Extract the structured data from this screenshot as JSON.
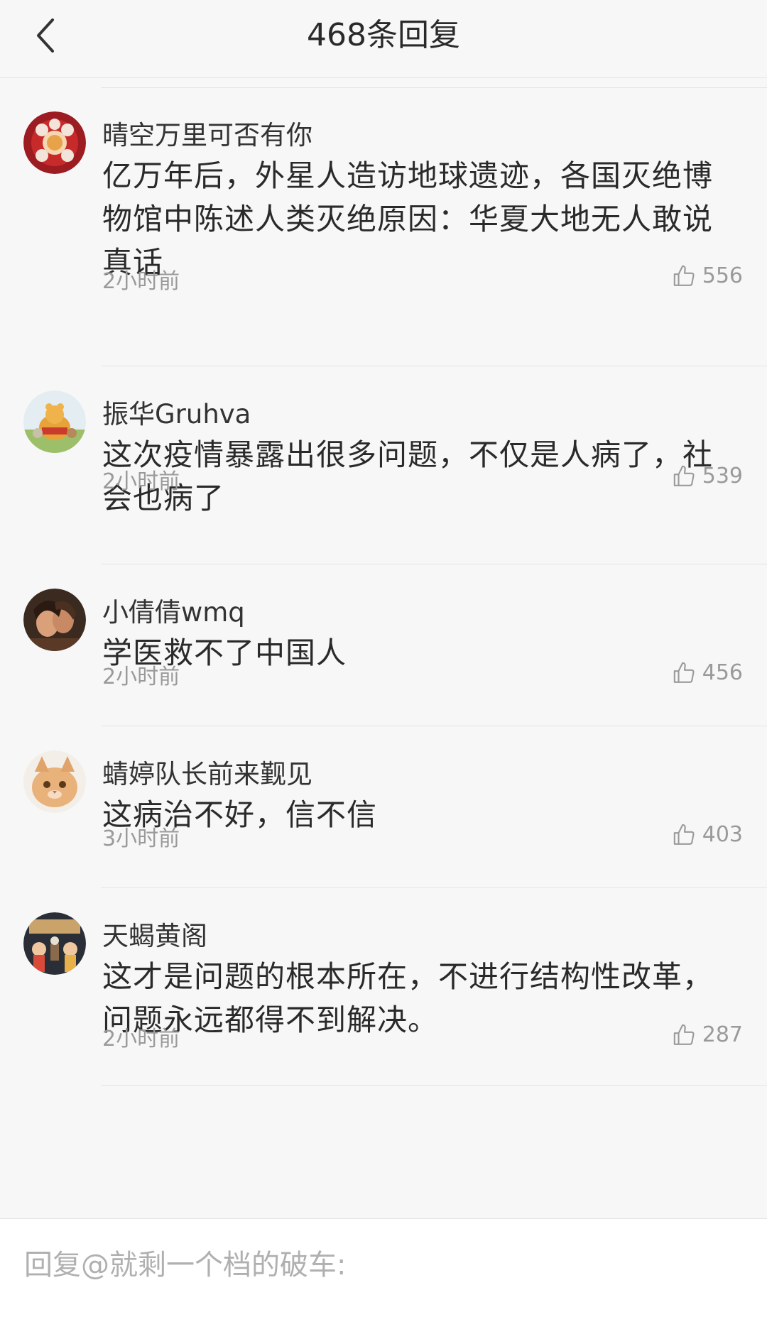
{
  "header": {
    "title": "468条回复"
  },
  "comments": [
    {
      "username": "晴空万里可否有你",
      "content": "亿万年后，外星人造访地球遗迹，各国灭绝博物馆中陈述人类灭绝原因：华夏大地无人敢说真话",
      "time": "2小时前",
      "likes": "556",
      "avatar": "lantern-avatar"
    },
    {
      "username": "振华Gruhva",
      "content": "这次疫情暴露出很多问题，不仅是人病了，社会也病了",
      "time": "2小时前",
      "likes": "539",
      "avatar": "cartoon-bear-avatar"
    },
    {
      "username": "小倩倩wmq",
      "content": "学医救不了中国人",
      "time": "2小时前",
      "likes": "456",
      "avatar": "couple-photo-avatar"
    },
    {
      "username": "蜻婷队长前来觐见",
      "content": "这病治不好，信不信",
      "time": "3小时前",
      "likes": "403",
      "avatar": "orange-cat-avatar"
    },
    {
      "username": "天蝎黄阁",
      "content": "这才是问题的根本所在，不进行结构性改革，问题永远都得不到解决。",
      "time": "2小时前",
      "likes": "287",
      "avatar": "cartoon-scene-avatar"
    }
  ],
  "reply": {
    "placeholder": "回复@就剩一个档的破车:"
  },
  "icons": {
    "back": "chevron-left-icon",
    "like": "thumbs-up-icon"
  },
  "colors": {
    "background": "#f7f7f7",
    "muted_text": "#9a9a9a",
    "body_text": "#2a2a2a"
  }
}
